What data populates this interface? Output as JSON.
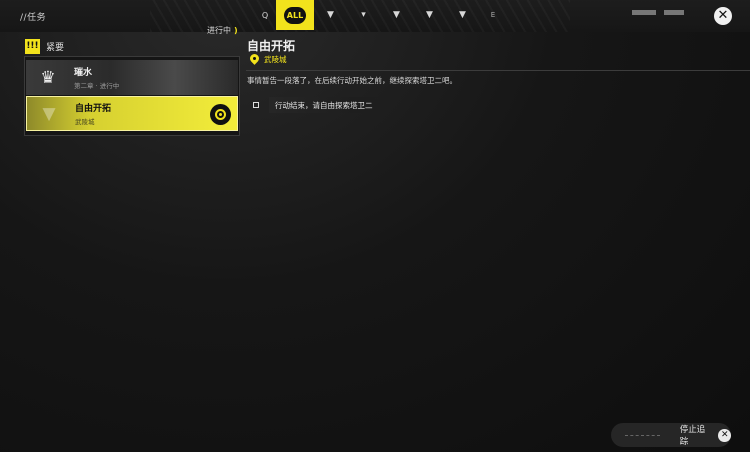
{
  "header": {
    "title": "//任务",
    "filters": [
      {
        "name": "filter-search",
        "label": "Q"
      },
      {
        "name": "filter-all",
        "label": "ALL"
      },
      {
        "name": "filter-main",
        "label": "▼"
      },
      {
        "name": "filter-side",
        "label": "▾"
      },
      {
        "name": "filter-event",
        "label": "▼"
      },
      {
        "name": "filter-daily",
        "label": "▼"
      },
      {
        "name": "filter-other",
        "label": "▼"
      },
      {
        "name": "filter-e",
        "label": "E"
      }
    ],
    "close_icon": "✕"
  },
  "quest_list": {
    "category_icon": "!!!",
    "category_label": "紧要",
    "items": [
      {
        "name": "璀水",
        "sub": "第二章 · 进行中",
        "emblem": "♛"
      },
      {
        "name": "自由开拓",
        "sub": "武陵城",
        "emblem": "▼"
      }
    ]
  },
  "detail": {
    "status_label": "进行中",
    "title": "自由开拓",
    "location": "武陵城",
    "description": "事情暂告一段落了，在后续行动开始之前，继续探索塔卫二吧。",
    "objectives": [
      "行动结束，请自由探索塔卫二"
    ]
  },
  "footer": {
    "stop_tracking_label": "停止追踪",
    "stop_icon": "✕"
  },
  "colors": {
    "accent": "#f2e21c",
    "background": "#141414"
  }
}
